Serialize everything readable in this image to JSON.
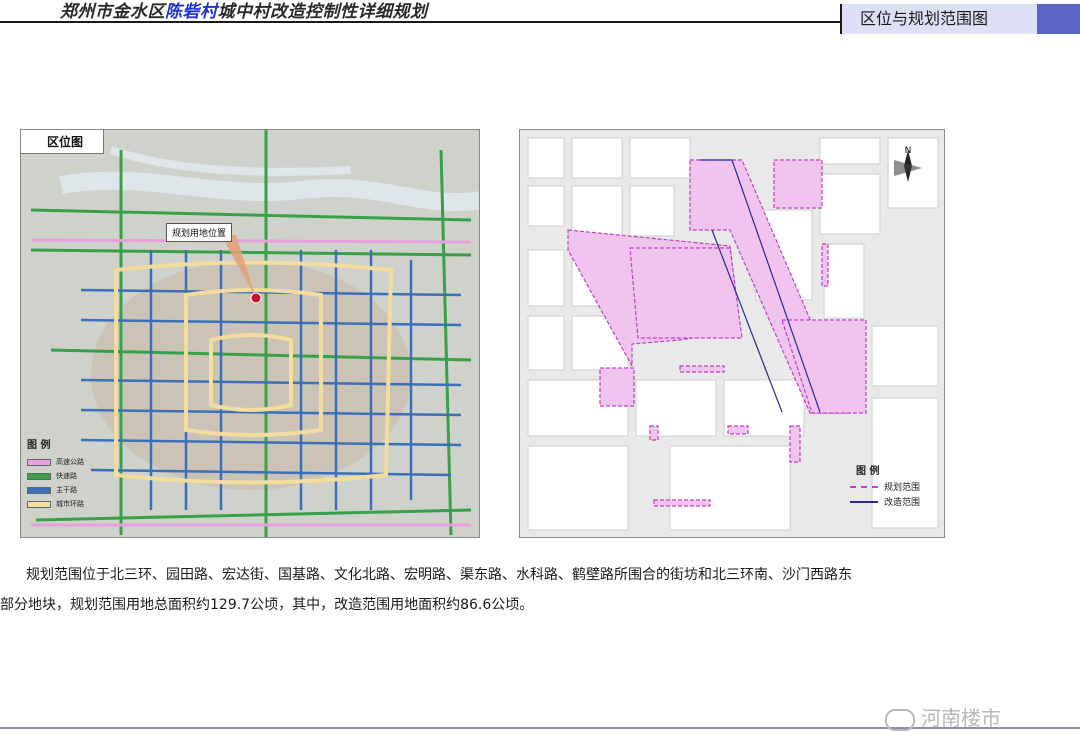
{
  "header": {
    "title_prefix": "郑州市金水区",
    "title_highlight": "陈砦村",
    "title_suffix": "城中村改造控制性详细规划",
    "section_tag": "区位与规划范围图"
  },
  "left_map": {
    "caption": "区位图",
    "site_label": "规划用地位置",
    "legend_title": "图 例",
    "legend": [
      {
        "label": "高速公路",
        "color": "#e7a3dd"
      },
      {
        "label": "快速路",
        "color": "#3aa14a"
      },
      {
        "label": "主干路",
        "color": "#3b6fb8"
      },
      {
        "label": "城市环路",
        "color": "#f3dfa2"
      }
    ]
  },
  "right_map": {
    "north": "N",
    "legend_title": "图 例",
    "legend": [
      {
        "label": "规划范围",
        "color": "#c040c0"
      },
      {
        "label": "改造范围",
        "color": "#2a2a9a"
      }
    ]
  },
  "description": {
    "line1": "规划范围位于北三环、园田路、宏达街、国基路、文化北路、宏明路、渠东路、水科路、鹤壁路所围合的街坊和北三环南、沙门西路东",
    "line2": "部分地块，规划范围用地总面积约129.7公顷，其中，改造范围用地面积约86.6公顷。"
  },
  "watermark": "河南楼市"
}
